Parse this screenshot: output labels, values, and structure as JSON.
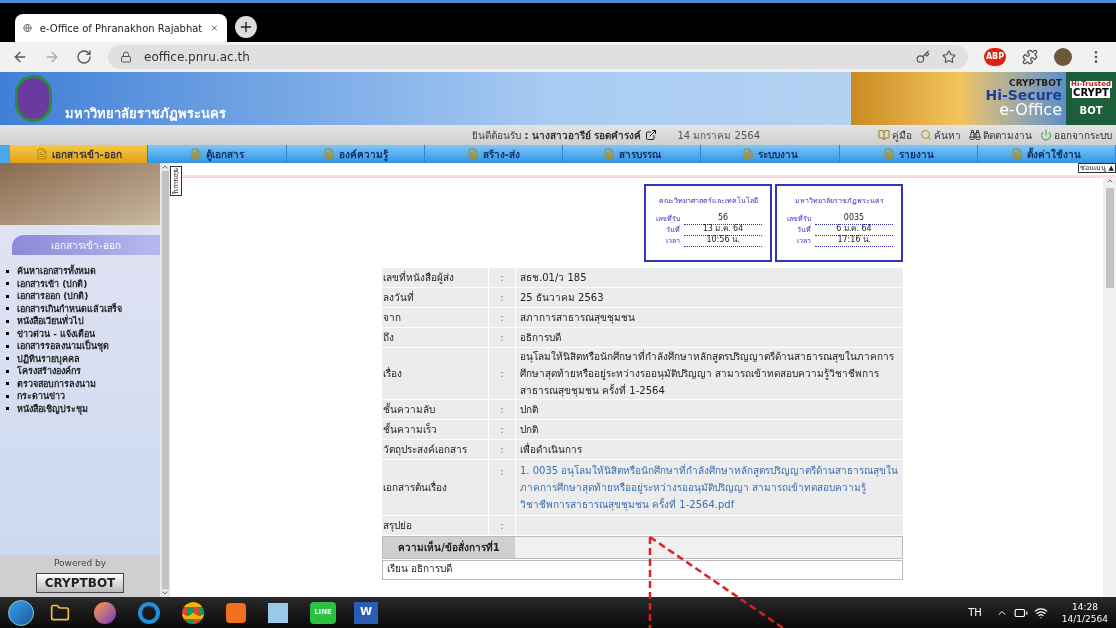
{
  "browser": {
    "tab_title": "e-Office of Phranakhon Rajabhat",
    "url": "eoffice.pnru.ac.th",
    "adblock_label": "ABP"
  },
  "header": {
    "site_title": "มหาวิทยาลัยราชภัฏพระนคร",
    "brand_top": "CRYPTBOT",
    "brand_mid": "Hi-Secure",
    "brand_bottom": "e-Office",
    "badge_top": "Hi-Trusted",
    "badge_mid": "CRYPT",
    "badge_bottom": "BOT"
  },
  "welcome": {
    "label": "ยินดีต้อนรับ",
    "user": ": นางสาวอารีย์ รอดคำรงค์",
    "date": "14 มกราคม 2564",
    "links": [
      {
        "label": "คู่มือ",
        "kind": "book"
      },
      {
        "label": "ค้นหา",
        "kind": "search"
      },
      {
        "label": "ติดตามงาน",
        "kind": "binoculars"
      },
      {
        "label": "ออกจากระบบ",
        "kind": "power"
      }
    ]
  },
  "nav": [
    {
      "label": "เอกสารเข้า-ออก",
      "selected": true
    },
    {
      "label": "ตู้เอกสาร",
      "selected": false
    },
    {
      "label": "องค์ความรู้",
      "selected": false
    },
    {
      "label": "สร้าง-ส่ง",
      "selected": false
    },
    {
      "label": "สารบรรณ",
      "selected": false
    },
    {
      "label": "ระบบงาน",
      "selected": false
    },
    {
      "label": "รายงาน",
      "selected": false
    },
    {
      "label": "ตั้งค่าใช้งาน",
      "selected": false
    }
  ],
  "sidebar": {
    "title": "เอกสารเข้า-ออก",
    "items": [
      "ค้นหาเอกสารทั้งหมด",
      "เอกสารเข้า (ปกติ)",
      "เอกสารออก (ปกติ)",
      "เอกสารเกินกำหนดแล้วเสร็จ",
      "หนังสือเวียนทั่วไป",
      "ข่าวด่วน - แจ้งเตือน",
      "เอกสารรอลงนามเป็นชุด",
      "ปฏิทินรายบุคคล",
      "โครงสร้างองค์กร",
      "ตรวจสอบการลงนาม",
      "กระดานข่าว",
      "หนังสือเชิญประชุม"
    ],
    "powered_by": "Powered by",
    "powered_logo": "CRYPTBOT",
    "hide_tab": "ซ่อนเมนู"
  },
  "hide_menu": "ซ่อนเมนู ▲",
  "stamps": [
    {
      "org": "คณะวิทยาศาสตร์และเทคโนโลยี",
      "rows": [
        {
          "label": "เลขที่รับ",
          "value": "56"
        },
        {
          "label": "วันที่",
          "value": "13 ม.ค. 64"
        },
        {
          "label": "เวลา",
          "value": "10:56 น."
        }
      ]
    },
    {
      "org": "มหาวิทยาลัยราชภัฏพระนคร",
      "rows": [
        {
          "label": "เลขที่รับ",
          "value": "0035"
        },
        {
          "label": "วันที่",
          "value": "6 ม.ค. 64"
        },
        {
          "label": "เวลา",
          "value": "17:16 น."
        }
      ]
    }
  ],
  "details": [
    {
      "label": "เลขที่หนังสือผู้ส่ง",
      "value": "สธช.01/ว 185",
      "kind": "text"
    },
    {
      "label": "ลงวันที่",
      "value": "25 ธันวาคม 2563",
      "kind": "text"
    },
    {
      "label": "จาก",
      "value": "สภาการสาธารณสุขชุมชน",
      "kind": "text"
    },
    {
      "label": "ถึง",
      "value": "อธิการบดี",
      "kind": "text"
    },
    {
      "label": "เรื่อง",
      "value": "อนุโลมให้นิสิตหรือนักศึกษาที่กำลังศึกษาหลักสูตรปริญญาตรีด้านสาธารณสุขในภาคการศึกษาสุดท้ายหรืออยู่ระหว่างรออนุมัติปริญญา สามารถเข้าทดสอบความรู้วิชาชีพการสาธารณสุขชุมชน ครั้งที่ 1-2564",
      "kind": "text"
    },
    {
      "label": "ชั้นความลับ",
      "value": "ปกติ",
      "kind": "text"
    },
    {
      "label": "ชั้นความเร็ว",
      "value": "ปกติ",
      "kind": "text"
    },
    {
      "label": "วัตถุประสงค์เอกสาร",
      "value": "เพื่อดำเนินการ",
      "kind": "text"
    },
    {
      "label": "เอกสารต้นเรื่อง",
      "value": "1. 0035 อนุโลมให้นิสิตหรือนักศึกษาที่กำลังศึกษาหลักสูตรปริญญาตรีด้านสาธารณสุขในภาคการศึกษาสุดท้ายหรืออยู่ระหว่างรออนุมัติปริญญา สามารถเข้าทดสอบความรู้วิชาชีพการสาธารณสุขชุมชน ครั้งที่ 1-2564.pdf",
      "kind": "link"
    },
    {
      "label": "สรุปย่อ",
      "kind": "text"
    }
  ],
  "separator": ":",
  "comment": {
    "heading": "ความเห็น/ข้อสั่งการที่1",
    "text": "เรียน อธิการบดี"
  },
  "taskbar": {
    "language": "TH",
    "time": "14:28",
    "date": "14/1/2564",
    "line_label": "LINE",
    "word_label": "W"
  }
}
